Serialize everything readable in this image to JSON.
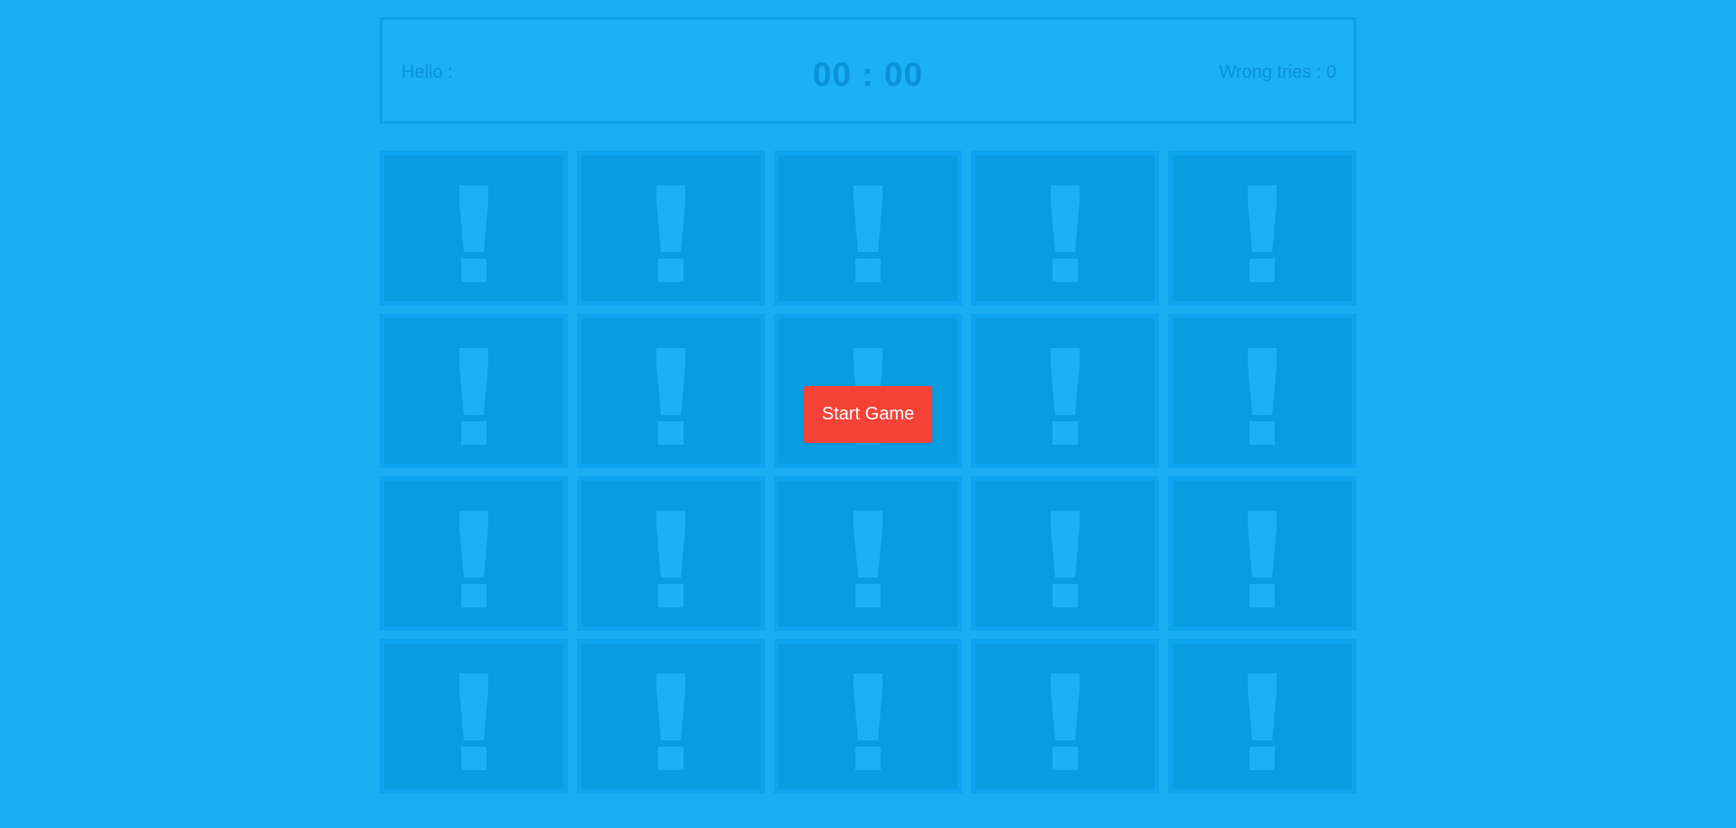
{
  "header": {
    "hello_label": "Hello :",
    "timer": "00 : 00",
    "wrong_tries_label": "Wrong tries : ",
    "wrong_tries_value": "0"
  },
  "board": {
    "rows": 4,
    "columns": 5,
    "card_face_icon": "exclamation-icon",
    "cards_revealed": 0
  },
  "start_button": {
    "label": "Start Game",
    "color": "#f44336"
  },
  "colors": {
    "background": "#1aaef3",
    "card_back": "#089ce1",
    "card_border": "#0ca5ee",
    "text_muted": "#0a91d6"
  }
}
